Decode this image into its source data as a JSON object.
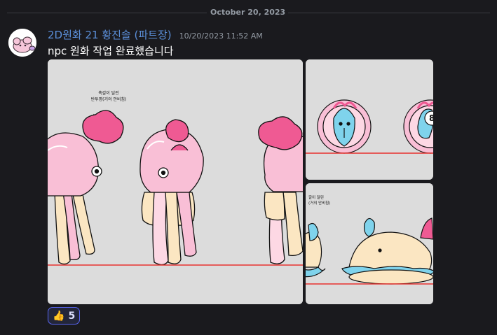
{
  "divider": {
    "date": "October 20, 2023"
  },
  "message": {
    "author": "2D원화 21 황진솔 (파트장)",
    "timestamp": "10/20/2023 11:52 AM",
    "content": "npc 원화 작업 완료했습니다",
    "attachments": {
      "big_annotation_line1": "촉갈이 달린",
      "big_annotation_line2": "반투명(거의 안비침)",
      "br_annotation_line1": "갈이 달린",
      "br_annotation_line2": "(거의 안비침)"
    },
    "reaction": {
      "emoji": "👍",
      "count": "5"
    }
  },
  "colors": {
    "background": "#1a1a1e",
    "username": "#5b8fd9",
    "jelly_pink": "#f9bfd6",
    "accent_pink": "#ef5a93",
    "tentacle_cream": "#fbe6c2",
    "guide_red": "#e8322e",
    "mint": "#7fd3ec"
  }
}
